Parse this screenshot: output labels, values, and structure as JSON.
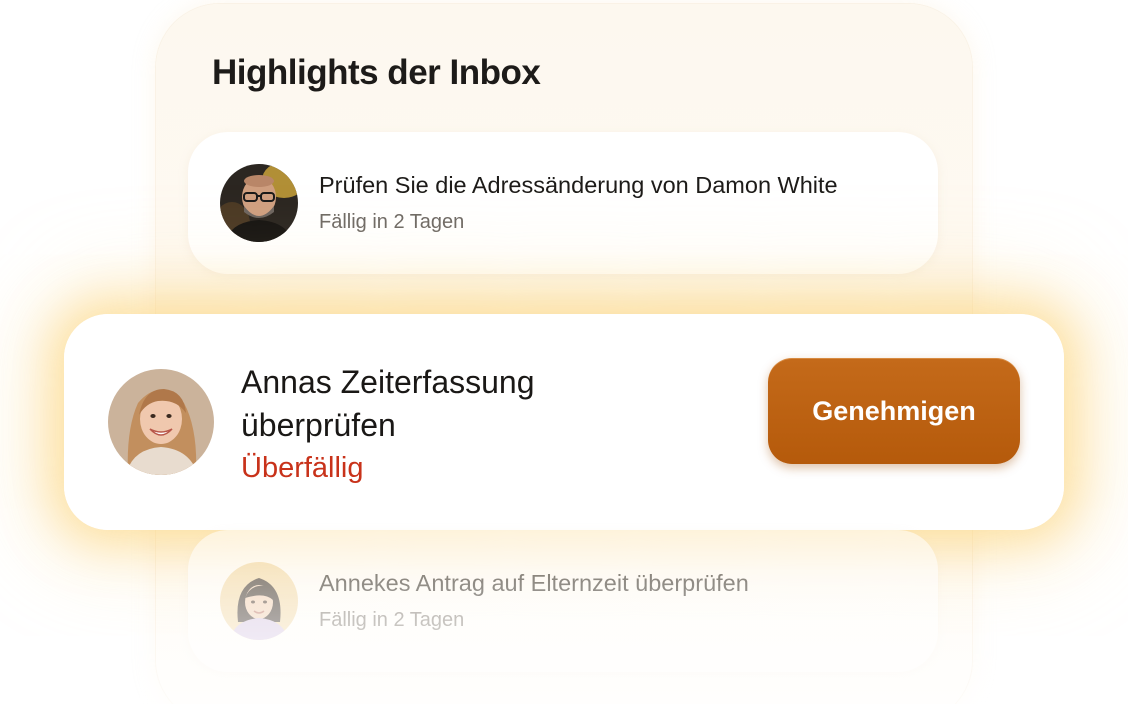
{
  "panel": {
    "title": "Highlights der Inbox"
  },
  "tasks": [
    {
      "title": "Prüfen Sie die Adressänderung von Damon White",
      "status": "Fällig in 2 Tagen",
      "avatar_icon": "man-with-glasses-avatar"
    },
    {
      "title": "Annas Zeiterfassung überprüfen",
      "status": "Überfällig",
      "status_color": "#c8321a",
      "action_label": "Genehmigen",
      "action_color": "#b8600f",
      "avatar_icon": "smiling-woman-avatar"
    },
    {
      "title": "Annekes Antrag auf Elternzeit überprüfen",
      "status": "Fällig in 2 Tagen",
      "avatar_icon": "woman-dark-hair-avatar"
    }
  ],
  "colors": {
    "panel_background": "#fdf8ef",
    "highlight_glow": "#fcd06e",
    "text_primary": "#1d1b19",
    "text_secondary": "#6f6a65"
  }
}
